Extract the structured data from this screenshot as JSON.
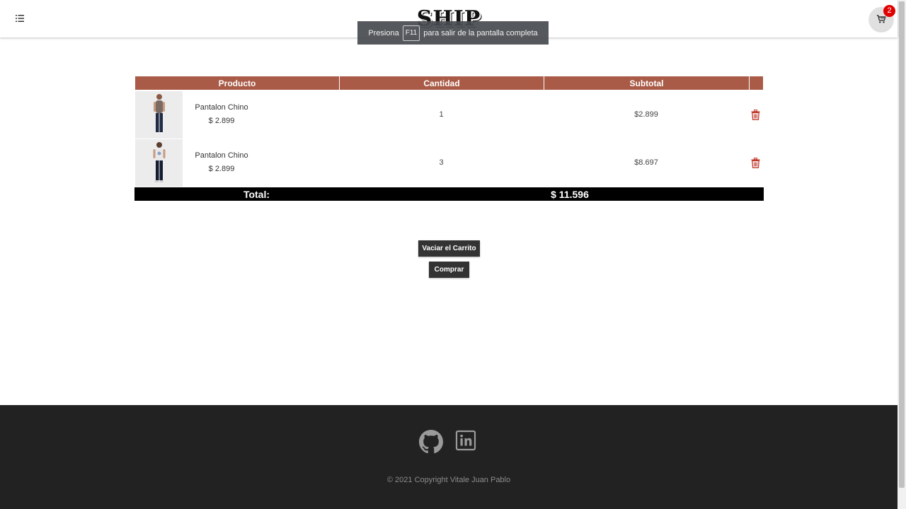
{
  "header": {
    "brand": "SHIP MARKET",
    "cart_count": "2"
  },
  "fullscreen_notice": {
    "prefix": "Presiona",
    "key": "F11",
    "suffix": "para salir de la pantalla completa"
  },
  "table": {
    "headers": {
      "product": "Producto",
      "quantity": "Cantidad",
      "subtotal": "Subtotal"
    },
    "rows": [
      {
        "name": "Pantalon Chino",
        "price": "$ 2.899",
        "quantity": "1",
        "subtotal": "$2.899",
        "shirt_color": "#7a6a62"
      },
      {
        "name": "Pantalon Chino",
        "price": "$ 2.899",
        "quantity": "3",
        "subtotal": "$8.697",
        "shirt_color": "#e8e8ea"
      }
    ],
    "total_label": "Total:",
    "total_value": "$ 11.596"
  },
  "actions": {
    "empty_cart": "Vaciar el Carrito",
    "buy": "Comprar"
  },
  "footer": {
    "icons": [
      "github-icon",
      "linkedin-icon"
    ],
    "copyright": "© 2021 Copyright Vitale Juan Pablo"
  },
  "colors": {
    "table_header": "#a95b47",
    "total_bar": "#000000",
    "button": "#333333",
    "footer": "#222222",
    "delete_icon": "#c0392b",
    "badge": "#e00000"
  }
}
